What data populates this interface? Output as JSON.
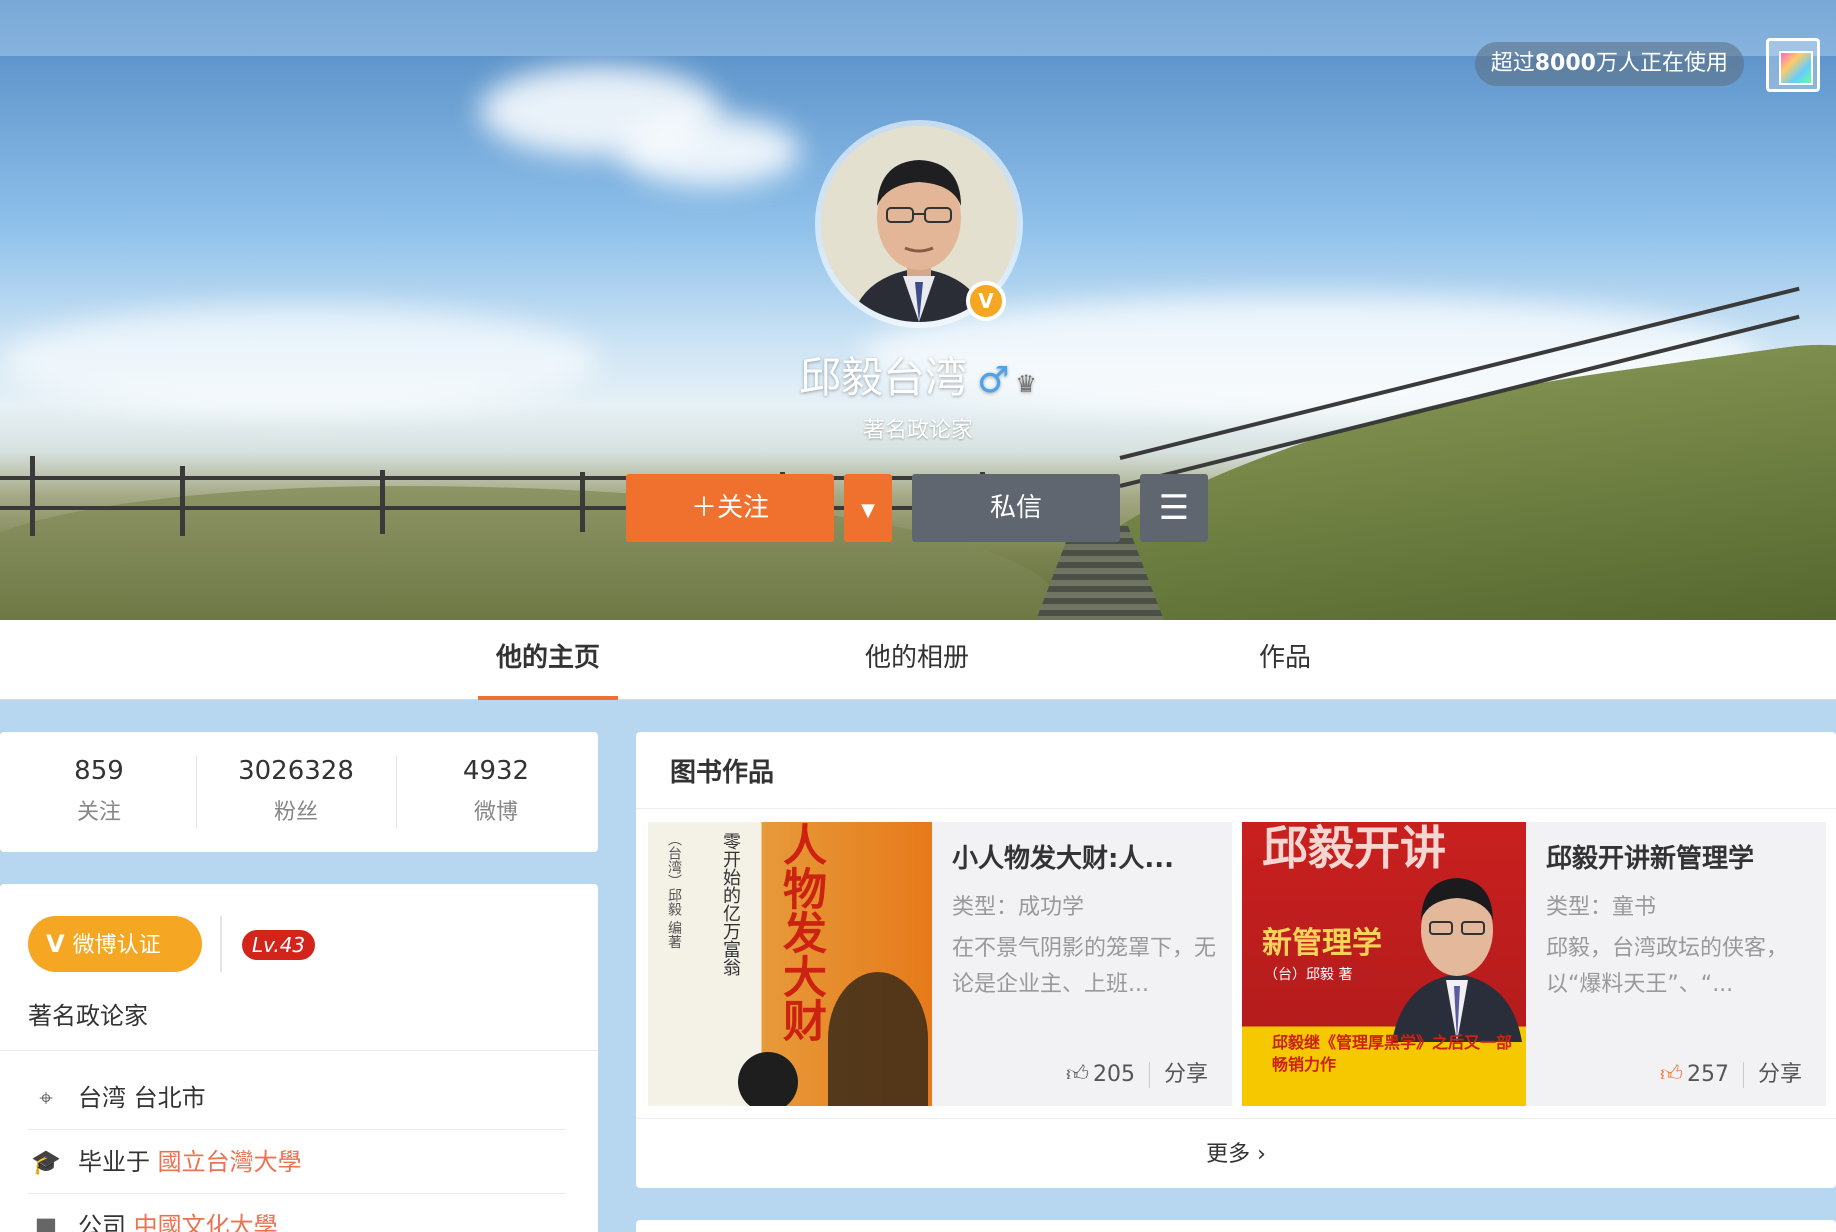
{
  "promo": {
    "prefix": "超过",
    "count": "8000",
    "suffix": "万人正在使用"
  },
  "profile": {
    "name": "邱毅台湾",
    "subtitle": "著名政论家",
    "verified": "V"
  },
  "actions": {
    "follow": "关注",
    "message": "私信"
  },
  "tabs": [
    {
      "label": "他的主页",
      "active": true
    },
    {
      "label": "他的相册",
      "active": false
    },
    {
      "label": "作品",
      "active": false
    }
  ],
  "stats": [
    {
      "num": "859",
      "label": "关注"
    },
    {
      "num": "3026328",
      "label": "粉丝"
    },
    {
      "num": "4932",
      "label": "微博"
    }
  ],
  "info": {
    "cert": "微博认证",
    "level": "Lv.43",
    "desc": "著名政论家",
    "location": "台湾 台北市",
    "edu_prefix": "毕业于",
    "edu_link": "國立台灣大學",
    "company_prefix": "公司",
    "company_link": "中國文化大學"
  },
  "books_section": {
    "title": "图书作品",
    "more": "更多",
    "items": [
      {
        "title": "小人物发大财:人...",
        "type": "类型：成功学",
        "desc": "在不景气阴影的笼罩下，无论是企业主、上班...",
        "likes": "205",
        "share": "分享",
        "cover_side": "（台湾）邱毅 编著",
        "cover_vertical": "零开始的亿万富翁",
        "cover_big": "人物发大财"
      },
      {
        "title": "邱毅开讲新管理学",
        "type": "类型：童书",
        "desc": "邱毅，台湾政坛的侠客，以“爆料天王”、“...",
        "likes": "257",
        "share": "分享",
        "cover_top": "邱毅开讲",
        "cover_mid": "新管理学",
        "cover_author": "（台）邱毅 著",
        "cover_bottom": "邱毅继《管理厚黑学》之后又一部畅销力作"
      }
    ]
  },
  "colors": {
    "accent": "#f0712e",
    "link": "#eb7350",
    "cert": "#f5a623",
    "level": "#d3241c",
    "dark_button": "#5f6670"
  }
}
